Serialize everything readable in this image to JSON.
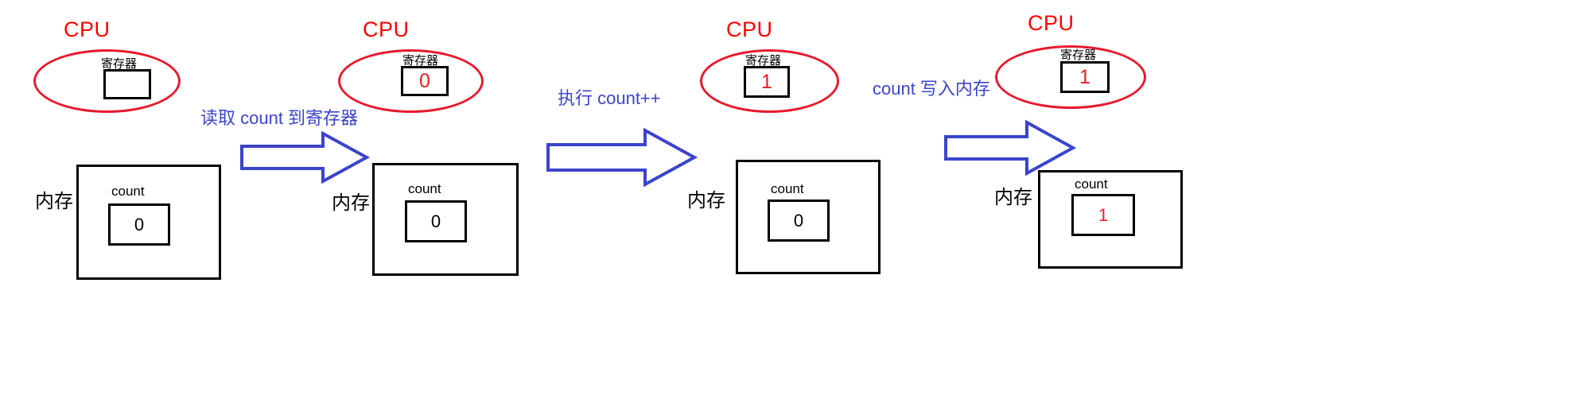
{
  "diagram": {
    "title": "CPU register and memory during count++",
    "colors": {
      "cpu_label": "#ff0000",
      "cpu_ellipse": "#e8192c",
      "box_border": "#000000",
      "arrow": "#3b44cc",
      "arrow_label": "#3b44cc",
      "value_red": "#ee1c25",
      "value_black": "#000000",
      "background": "#ffffff"
    },
    "stages": [
      {
        "id": "stage-1",
        "cpu_label": "CPU",
        "register_label": "寄存器",
        "register_value": "",
        "register_value_color": "black",
        "memory_label": "内存",
        "memory_cell_label": "count",
        "memory_cell_value": "0",
        "memory_cell_value_color": "black"
      },
      {
        "id": "stage-2",
        "cpu_label": "CPU",
        "register_label": "寄存器",
        "register_value": "0",
        "register_value_color": "red",
        "memory_label": "内存",
        "memory_cell_label": "count",
        "memory_cell_value": "0",
        "memory_cell_value_color": "black"
      },
      {
        "id": "stage-3",
        "cpu_label": "CPU",
        "register_label": "寄存器",
        "register_value": "1",
        "register_value_color": "red",
        "memory_label": "内存",
        "memory_cell_label": "count",
        "memory_cell_value": "0",
        "memory_cell_value_color": "black"
      },
      {
        "id": "stage-4",
        "cpu_label": "CPU",
        "register_label": "寄存器",
        "register_value": "1",
        "register_value_color": "red",
        "memory_label": "内存",
        "memory_cell_label": "count",
        "memory_cell_value": "1",
        "memory_cell_value_color": "red"
      }
    ],
    "transitions": [
      {
        "id": "transition-1",
        "label": "读取 count 到寄存器"
      },
      {
        "id": "transition-2",
        "label": "执行 count++"
      },
      {
        "id": "transition-3",
        "label": "count 写入内存"
      }
    ]
  }
}
